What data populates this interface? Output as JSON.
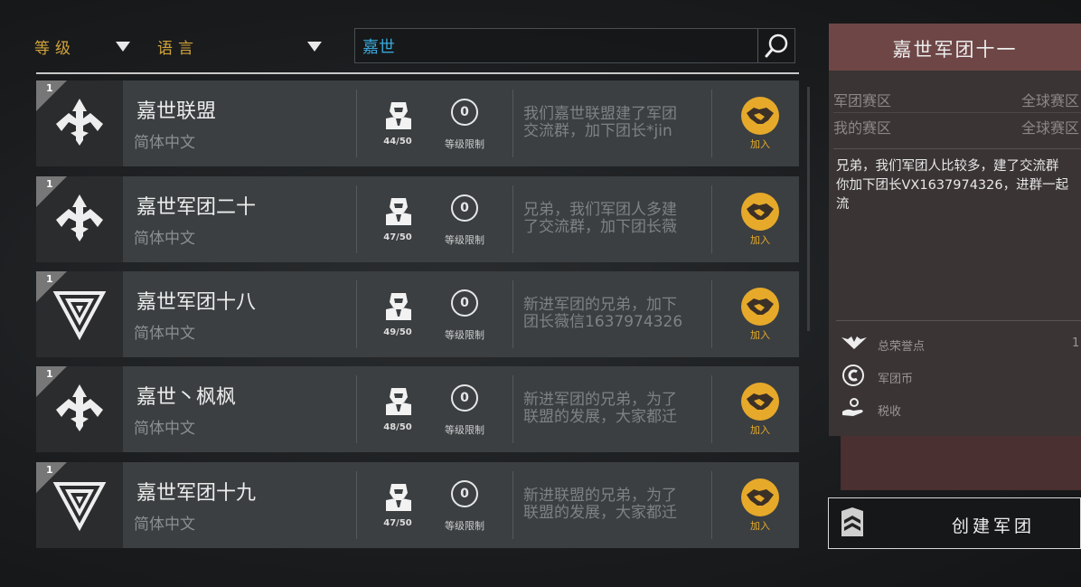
{
  "filters": {
    "level_label": "等级",
    "language_label": "语言"
  },
  "search": {
    "value": "嘉世"
  },
  "guilds": [
    {
      "rank": "1",
      "name": "嘉世联盟",
      "language": "简体中文",
      "members": "44/50",
      "level_limit_value": "0",
      "level_limit_label": "等级限制",
      "desc_line1": "我们嘉世联盟建了军团",
      "desc_line2": "交流群，加下团长*jin",
      "join_label": "加入"
    },
    {
      "rank": "1",
      "name": "嘉世军团二十",
      "language": "简体中文",
      "members": "47/50",
      "level_limit_value": "0",
      "level_limit_label": "等级限制",
      "desc_line1": "兄弟，我们军团人多建",
      "desc_line2": "了交流群，加下团长薇",
      "join_label": "加入"
    },
    {
      "rank": "1",
      "name": "嘉世军团十八",
      "language": "简体中文",
      "members": "49/50",
      "level_limit_value": "0",
      "level_limit_label": "等级限制",
      "desc_line1": "新进军团的兄弟，加下",
      "desc_line2": "团长薇信1637974326",
      "join_label": "加入"
    },
    {
      "rank": "1",
      "name": "嘉世丶枫枫",
      "language": "简体中文",
      "members": "48/50",
      "level_limit_value": "0",
      "level_limit_label": "等级限制",
      "desc_line1": "新进军团的兄弟，为了",
      "desc_line2": "联盟的发展，大家都迁",
      "join_label": "加入"
    },
    {
      "rank": "1",
      "name": "嘉世军团十九",
      "language": "简体中文",
      "members": "47/50",
      "level_limit_value": "0",
      "level_limit_label": "等级限制",
      "desc_line1": "新进联盟的兄弟，为了",
      "desc_line2": "联盟的发展，大家都迁",
      "join_label": "加入"
    }
  ],
  "detail": {
    "title": "嘉世军团十一",
    "region_label": "军团赛区",
    "region_value": "全球赛区",
    "my_region_label": "我的赛区",
    "my_region_value": "全球赛区",
    "desc_line1": "兄弟，我们军团人比较多，建了交流群",
    "desc_line2": "你加下团长VX1637974326，进群一起",
    "desc_line3": "流",
    "honor_label": "总荣誉点",
    "honor_value": "1",
    "coin_label": "军团币",
    "tax_label": "税收"
  },
  "create_button": {
    "label": "创建军团"
  },
  "colors": {
    "accent_gold": "#e6a92a",
    "search_text": "#3aa6d8",
    "panel_head": "#6e4646"
  },
  "icons": {
    "search": "magnifier-icon",
    "emblem_a": "winged-sword-emblem-icon",
    "emblem_b": "triangle-emblem-icon",
    "member": "helmet-icon",
    "join": "handshake-icon"
  }
}
